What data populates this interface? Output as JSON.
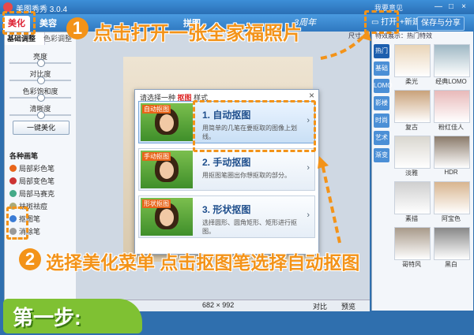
{
  "window": {
    "title": "美图秀秀 3.0.4",
    "feedback": "我要意见",
    "minimize": "—",
    "maximize": "□",
    "close": "×"
  },
  "tabs": {
    "beautify": "美化",
    "cosmetics": "美容",
    "collage": "拼图",
    "anniversary": "3周年"
  },
  "toolbar": {
    "open": "打开",
    "new": "新建",
    "save_share": "保存与分享"
  },
  "left_panel": {
    "subtabs": [
      "基础调整",
      "色彩调整"
    ],
    "sliders": [
      {
        "label": "亮度",
        "value": 0.5
      },
      {
        "label": "对比度",
        "value": 0.5
      },
      {
        "label": "色彩饱和度",
        "value": 0.5
      },
      {
        "label": "清晰度",
        "value": 0.5
      }
    ],
    "one_click": "一键美化",
    "brushes_title": "各种画笔",
    "brushes": [
      "局部彩色笔",
      "局部变色笔",
      "局部马赛克",
      "祛斑祛痘",
      "抠图笔",
      "消除笔"
    ]
  },
  "status": {
    "size": "682 × 992",
    "compare": "对比",
    "preview": "预览"
  },
  "right_panel": {
    "header": "特效展示：热门特效",
    "size_label": "尺寸",
    "categories": [
      "热门",
      "基础",
      "LOMO",
      "影楼",
      "时尚",
      "艺术",
      "渐变"
    ],
    "effects": [
      "柔光",
      "经典LOMO",
      "复古",
      "粉红佳人",
      "淡雅",
      "HDR",
      "素描",
      "阿宝色",
      "哥特风",
      "黑白"
    ]
  },
  "dialog": {
    "title_prefix": "请选择一种",
    "title_key": "抠图",
    "title_suffix": "样式",
    "close": "×",
    "options": [
      {
        "badge": "自动抠图",
        "name": "1. 自动抠图",
        "desc": "用简单的几笔在要抠取的图像上划线。"
      },
      {
        "badge": "手动抠图",
        "name": "2. 手动抠图",
        "desc": "用抠图笔圈出你想抠取的部分。"
      },
      {
        "badge": "形状抠图",
        "name": "3. 形状抠图",
        "desc": "选择圆形、圆角矩形、矩形进行抠图。"
      }
    ]
  },
  "annotations": {
    "step1_num": "1",
    "step1_text": "点击打开一张全家福照片",
    "step2_num": "2",
    "step2_text": "选择美化菜单 点击抠图笔选择自动抠图",
    "step_label": "第一步:"
  },
  "colors": {
    "annotation": "#f39319",
    "step_box": "#7fc133",
    "titlebar": "#2f78c0"
  }
}
